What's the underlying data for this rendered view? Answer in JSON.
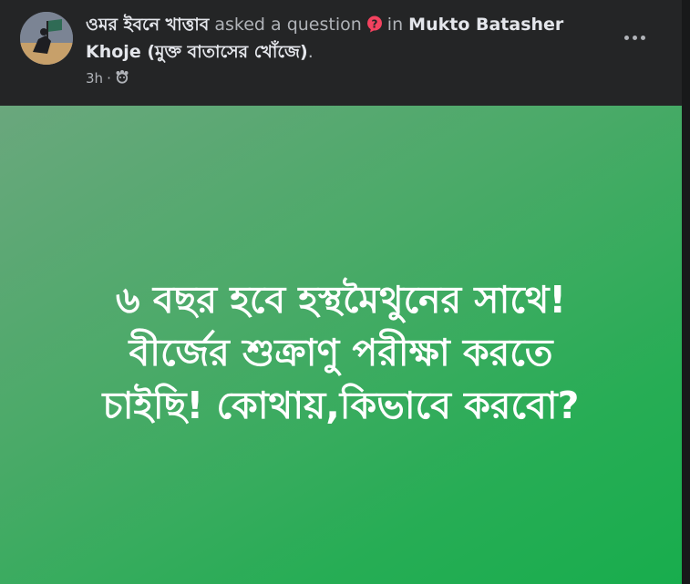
{
  "post": {
    "author": "ওমর ইবনে খাত্তাব",
    "action": "asked a question",
    "preposition": "in",
    "group": "Mukto Batasher Khoje (মুক্ত বাতাসের খোঁজে)",
    "period": ".",
    "time": "3h",
    "separator": "·",
    "audience_icon": "group-audience-icon",
    "question_icon": "question-bubble-icon",
    "more_icon": "more-options-icon"
  },
  "question": {
    "text": "৬ বছর হবে হস্থমৈথুনের সাথে!\nবীর্জের শুক্রাণু পরীক্ষা করতে\nচাইছি! কোথায়,কিভাবে করবো?"
  },
  "colors": {
    "card": "#242526",
    "question_bg_start": "#6aa77d",
    "question_bg_end": "#18ad4d",
    "question_icon": "#f3425f"
  }
}
